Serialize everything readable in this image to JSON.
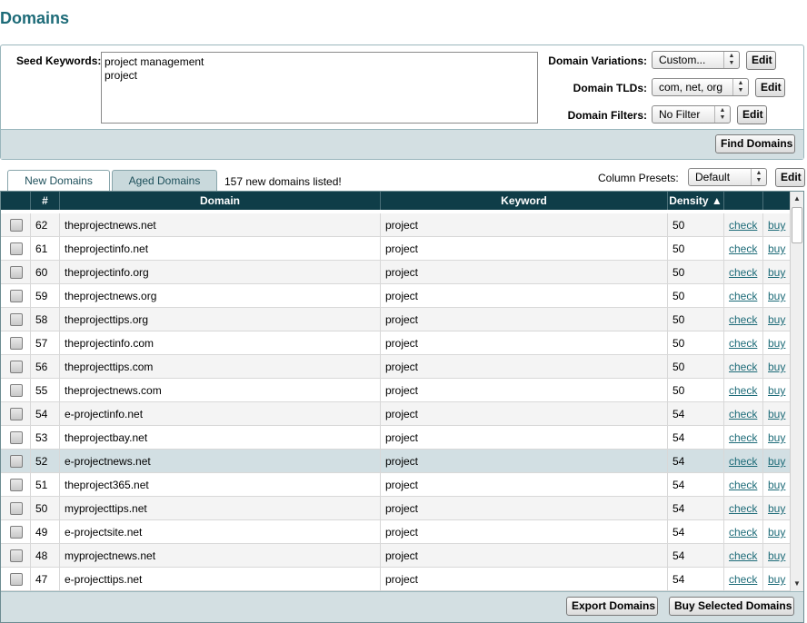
{
  "page": {
    "title": "Domains"
  },
  "search": {
    "seed_label": "Seed Keywords:",
    "seed_value": "project management\nproject",
    "variations_label": "Domain Variations:",
    "variations_value": "Custom...",
    "tlds_label": "Domain TLDs:",
    "tlds_value": "com, net, org",
    "filters_label": "Domain Filters:",
    "filters_value": "No Filter",
    "edit_label": "Edit",
    "find_label": "Find Domains"
  },
  "tabs": [
    {
      "label": "New Domains",
      "active": true
    },
    {
      "label": "Aged Domains",
      "active": false
    }
  ],
  "listed_count": "157 new domains listed!",
  "presets": {
    "label": "Column Presets:",
    "value": "Default",
    "edit_label": "Edit"
  },
  "grid": {
    "columns": [
      "",
      "#",
      "Domain",
      "Keyword",
      "Density ▲",
      "",
      ""
    ],
    "sort_indicator": "ascending",
    "rows": [
      {
        "num": "62",
        "domain": "theprojectnews.net",
        "keyword": "project",
        "density": "50",
        "check": "check",
        "buy": "buy"
      },
      {
        "num": "61",
        "domain": "theprojectinfo.net",
        "keyword": "project",
        "density": "50",
        "check": "check",
        "buy": "buy"
      },
      {
        "num": "60",
        "domain": "theprojectinfo.org",
        "keyword": "project",
        "density": "50",
        "check": "check",
        "buy": "buy"
      },
      {
        "num": "59",
        "domain": "theprojectnews.org",
        "keyword": "project",
        "density": "50",
        "check": "check",
        "buy": "buy"
      },
      {
        "num": "58",
        "domain": "theprojecttips.org",
        "keyword": "project",
        "density": "50",
        "check": "check",
        "buy": "buy"
      },
      {
        "num": "57",
        "domain": "theprojectinfo.com",
        "keyword": "project",
        "density": "50",
        "check": "check",
        "buy": "buy"
      },
      {
        "num": "56",
        "domain": "theprojecttips.com",
        "keyword": "project",
        "density": "50",
        "check": "check",
        "buy": "buy"
      },
      {
        "num": "55",
        "domain": "theprojectnews.com",
        "keyword": "project",
        "density": "50",
        "check": "check",
        "buy": "buy"
      },
      {
        "num": "54",
        "domain": "e-projectinfo.net",
        "keyword": "project",
        "density": "54",
        "check": "check",
        "buy": "buy"
      },
      {
        "num": "53",
        "domain": "theprojectbay.net",
        "keyword": "project",
        "density": "54",
        "check": "check",
        "buy": "buy"
      },
      {
        "num": "52",
        "domain": "e-projectnews.net",
        "keyword": "project",
        "density": "54",
        "check": "check",
        "buy": "buy",
        "selected": true
      },
      {
        "num": "51",
        "domain": "theproject365.net",
        "keyword": "project",
        "density": "54",
        "check": "check",
        "buy": "buy"
      },
      {
        "num": "50",
        "domain": "myprojecttips.net",
        "keyword": "project",
        "density": "54",
        "check": "check",
        "buy": "buy"
      },
      {
        "num": "49",
        "domain": "e-projectsite.net",
        "keyword": "project",
        "density": "54",
        "check": "check",
        "buy": "buy"
      },
      {
        "num": "48",
        "domain": "myprojectnews.net",
        "keyword": "project",
        "density": "54",
        "check": "check",
        "buy": "buy"
      },
      {
        "num": "47",
        "domain": "e-projecttips.net",
        "keyword": "project",
        "density": "54",
        "check": "check",
        "buy": "buy"
      }
    ]
  },
  "footer": {
    "export_label": "Export Domains",
    "buy_selected_label": "Buy Selected Domains"
  },
  "icons": {
    "spinner": "up-down-spinner-icon",
    "scroll_up": "scroll-up-arrow-icon",
    "scroll_down": "scroll-down-arrow-icon"
  },
  "colors": {
    "title": "#1d6b78",
    "header_bg": "#0f3d48",
    "panel_bg": "#d3dfe2",
    "link": "#1d6b78",
    "selected_row": "#d2dfe3"
  }
}
